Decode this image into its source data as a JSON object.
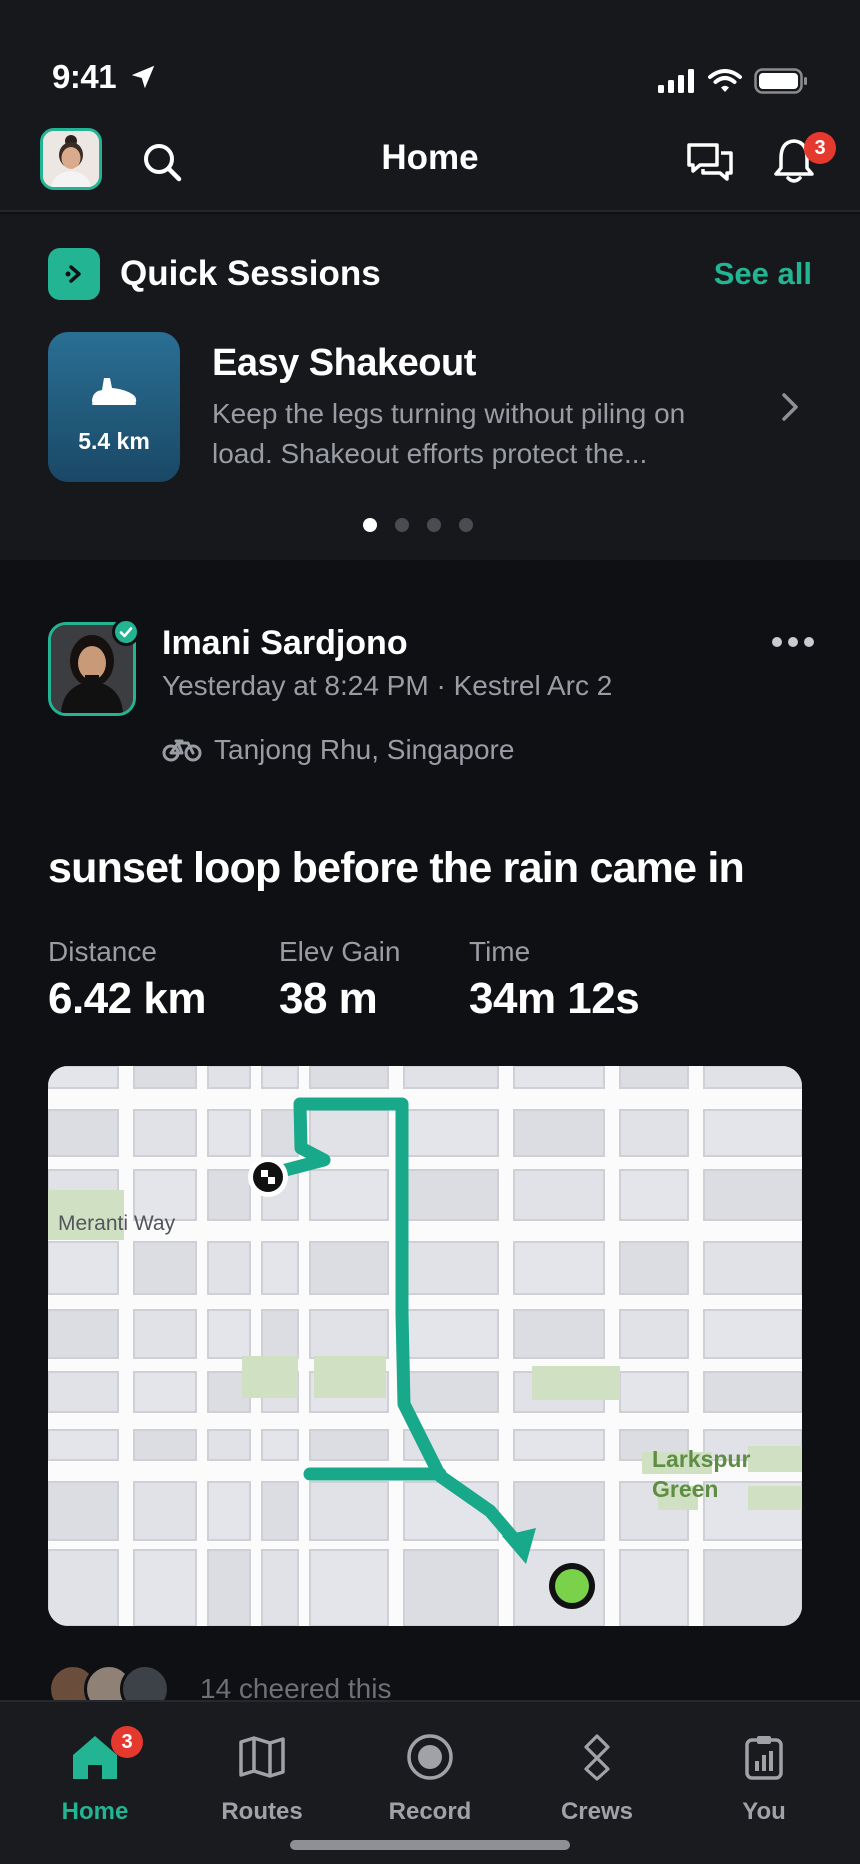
{
  "status_bar": {
    "time": "9:41"
  },
  "header": {
    "title": "Home",
    "notifications_badge": "3"
  },
  "quick_sessions": {
    "title": "Quick Sessions",
    "see_all": "See all",
    "card": {
      "distance": "5.4 km",
      "title": "Easy Shakeout",
      "description": "Keep the legs turning without piling on load. Shakeout efforts protect the..."
    },
    "page_count": 4,
    "active_page": 1
  },
  "post": {
    "author": "Imani Sardjono",
    "meta": "Yesterday at 8:24 PM · Kestrel Arc 2",
    "location": "Tanjong Rhu, Singapore",
    "title": "sunset loop before the rain came in",
    "stats": [
      {
        "label": "Distance",
        "value": "6.42 km"
      },
      {
        "label": "Elev Gain",
        "value": "38 m"
      },
      {
        "label": "Time",
        "value": "34m 12s"
      }
    ],
    "map": {
      "street_label": "Meranti Way",
      "park_label": "Larkspur Green"
    },
    "cheers": "14 cheered this"
  },
  "tab_bar": {
    "tabs": [
      {
        "label": "Home",
        "badge": "3",
        "icon": "home-icon",
        "active": true
      },
      {
        "label": "Routes",
        "icon": "map-icon"
      },
      {
        "label": "Record",
        "icon": "record-icon"
      },
      {
        "label": "Crews",
        "icon": "crews-icon"
      },
      {
        "label": "You",
        "icon": "you-icon"
      }
    ]
  },
  "colors": {
    "accent": "#23b493",
    "badge": "#e5392f",
    "route": "#18a88a",
    "finish": "#7ad14a"
  }
}
